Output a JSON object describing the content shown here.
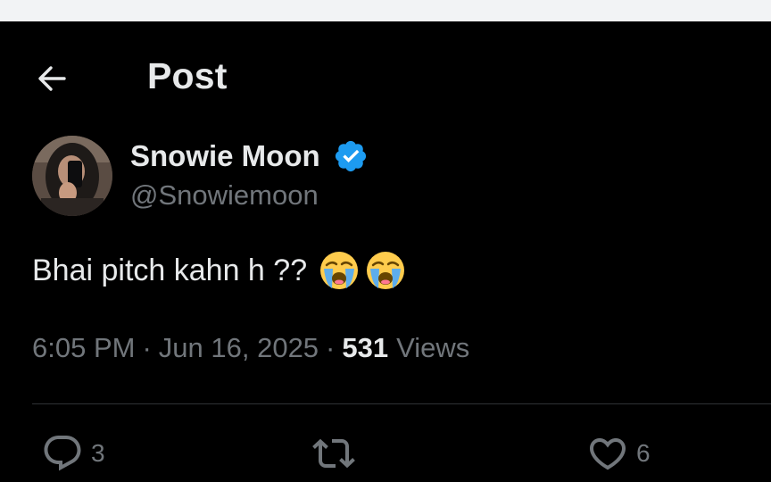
{
  "header": {
    "title": "Post",
    "back_icon": "arrow-left-icon"
  },
  "author": {
    "display_name": "Snowie Moon",
    "handle": "@Snowiemoon",
    "verified_icon": "verified-badge-icon",
    "verified_color": "#1d9bf0"
  },
  "post": {
    "text": "Bhai pitch kahn h ??",
    "emojis": [
      "loudly-crying-face-icon",
      "loudly-crying-face-icon"
    ],
    "time": "6:05 PM",
    "separator": "·",
    "date": "Jun 16, 2025",
    "views_count": "531",
    "views_label": "Views"
  },
  "actions": {
    "reply_count": "3",
    "retweet_count": "",
    "like_count": "6"
  },
  "colors": {
    "background": "#000000",
    "text_primary": "#e7e9ea",
    "text_secondary": "#71767b",
    "divider": "#2f3336"
  }
}
